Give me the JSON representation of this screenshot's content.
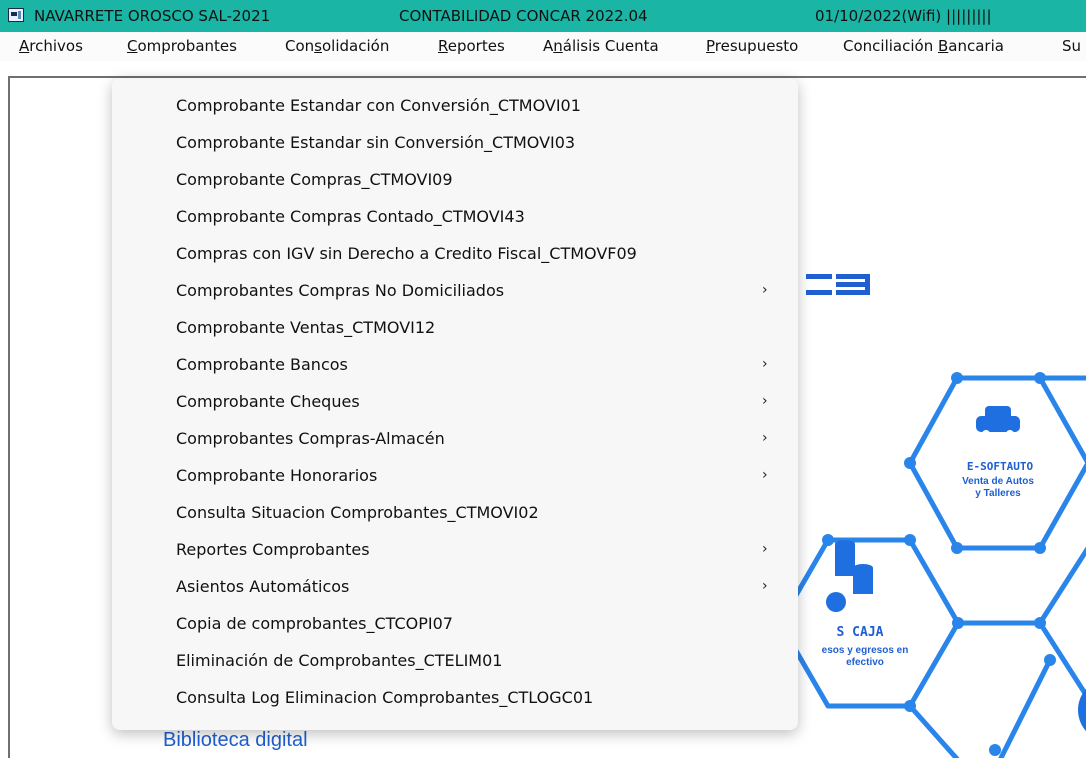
{
  "titlebar": {
    "company": "NAVARRETE OROSCO SAL-2021",
    "app": "CONTABILIDAD CONCAR 2022.04",
    "status": "01/10/2022(Wifi) |||||||||"
  },
  "menubar": [
    {
      "pre": "",
      "u": "A",
      "post": "rchivos"
    },
    {
      "pre": "",
      "u": "C",
      "post": "omprobantes"
    },
    {
      "pre": "Con",
      "u": "s",
      "post": "olidación"
    },
    {
      "pre": "",
      "u": "R",
      "post": "eportes"
    },
    {
      "pre": "A",
      "u": "n",
      "post": "álisis Cuenta"
    },
    {
      "pre": "",
      "u": "P",
      "post": "resupuesto"
    },
    {
      "pre": "Conciliación ",
      "u": "B",
      "post": "ancaria"
    },
    {
      "pre": "Su",
      "u": "",
      "post": ""
    }
  ],
  "dropdown": [
    {
      "label": "Comprobante Estandar con Conversión_CTMOVI01",
      "submenu": false
    },
    {
      "label": "Comprobante Estandar sin Conversión_CTMOVI03",
      "submenu": false
    },
    {
      "label": "Comprobante Compras_CTMOVI09",
      "submenu": false
    },
    {
      "label": "Comprobante Compras Contado_CTMOVI43",
      "submenu": false
    },
    {
      "label": "Compras con IGV sin Derecho a Credito Fiscal_CTMOVF09",
      "submenu": false
    },
    {
      "label": "Comprobantes Compras No Domiciliados",
      "submenu": true
    },
    {
      "label": "Comprobante Ventas_CTMOVI12",
      "submenu": false
    },
    {
      "label": "Comprobante Bancos",
      "submenu": true
    },
    {
      "label": "Comprobante Cheques",
      "submenu": true
    },
    {
      "label": "Comprobantes Compras-Almacén",
      "submenu": true
    },
    {
      "label": "Comprobante Honorarios",
      "submenu": true
    },
    {
      "label": "Consulta Situacion Comprobantes_CTMOVI02",
      "submenu": false
    },
    {
      "label": "Reportes Comprobantes",
      "submenu": true
    },
    {
      "label": "Asientos Automáticos",
      "submenu": true
    },
    {
      "label": "Copia de comprobantes_CTCOPI07",
      "submenu": false
    },
    {
      "label": "Eliminación de Comprobantes_CTELIM01",
      "submenu": false
    },
    {
      "label": "Consulta Log Eliminacion Comprobantes_CTLOGC01",
      "submenu": false
    }
  ],
  "submenu_arrow": "›",
  "background": {
    "logo_fragment": "CB",
    "softauto_title": "E-SOFTAUTO",
    "softauto_sub1": "Venta de Autos",
    "softauto_sub2": "y Talleres",
    "caja_title": "S CAJA",
    "caja_sub1": "esos y egresos en",
    "caja_sub2": "efectivo",
    "biblioteca": "Biblioteca digital"
  },
  "colors": {
    "titlebar": "#1ab5a5",
    "accent_blue": "#1f5fd0",
    "hex_line": "#2a85ea"
  }
}
